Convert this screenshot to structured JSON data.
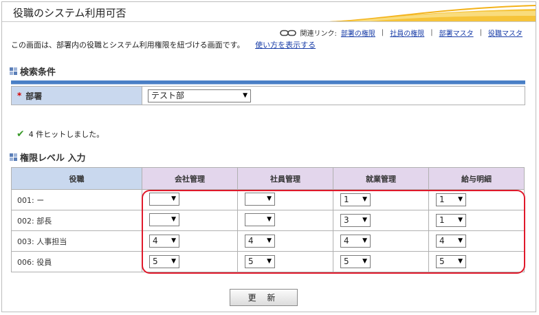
{
  "title": "役職のシステム利用可否",
  "related": {
    "label": "関連リンク:",
    "links": [
      "部署の権限",
      "社員の権限",
      "部署マスタ",
      "役職マスタ"
    ]
  },
  "description": "この画面は、部署内の役職とシステム利用権限を紐づける画面です。",
  "help_link": "使い方を表示する",
  "search": {
    "section_title": "検索条件",
    "required_mark": "*",
    "field_label": "部署",
    "field_value": "テスト部"
  },
  "result_message": "4 件ヒットしました。",
  "permissions": {
    "section_title": "権限レベル 入力",
    "columns": [
      "役職",
      "会社管理",
      "社員管理",
      "就業管理",
      "給与明細"
    ],
    "rows": [
      {
        "role": "001: ー",
        "values": [
          "",
          "",
          "1",
          "1"
        ]
      },
      {
        "role": "002: 部長",
        "values": [
          "",
          "",
          "3",
          "1"
        ]
      },
      {
        "role": "003: 人事担当",
        "values": [
          "4",
          "4",
          "4",
          "4"
        ]
      },
      {
        "role": "006: 役員",
        "values": [
          "5",
          "5",
          "5",
          "5"
        ]
      }
    ]
  },
  "update_button": "更 新",
  "colors": {
    "role_header_bg": "#c9d8ee",
    "perm_header_bg": "#e3d6ec",
    "highlight_border": "#e0182a",
    "link": "#1a3ea8",
    "accent_bar": "#4a7fc6"
  }
}
